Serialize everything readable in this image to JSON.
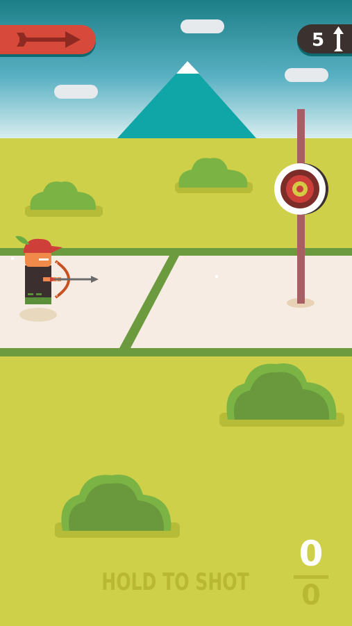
{
  "game": {
    "arrows_left": "5",
    "hint_text": "HOLD TO SHOT",
    "score": "0",
    "best_score": "0"
  },
  "icons": {
    "wind": "right-arrow-icon",
    "arrows": "up-arrow-icon"
  },
  "colors": {
    "sky_top": "#1c7f87",
    "sky_bottom": "#d9eef0",
    "grass": "#cfd04a",
    "path": "#f6ece3",
    "path_border": "#6c9a3e",
    "wind_button": "#d74a3b",
    "target_red": "#cc3e3a"
  }
}
